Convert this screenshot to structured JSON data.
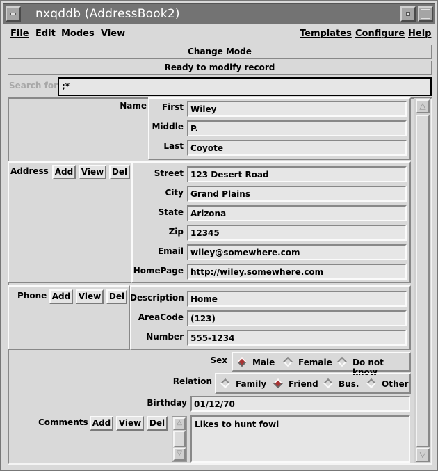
{
  "window": {
    "title": "nxqddb (AddressBook2)"
  },
  "menu": {
    "file": "File",
    "edit": "Edit",
    "modes": "Modes",
    "view": "View",
    "templates": "Templates",
    "configure": "Configure",
    "help": "Help"
  },
  "status": {
    "change_mode": "Change Mode",
    "message": "Ready to modify record"
  },
  "search": {
    "label": "Search for",
    "value": ";*"
  },
  "name": {
    "label": "Name",
    "first_label": "First",
    "first": "Wiley",
    "middle_label": "Middle",
    "middle": "P.",
    "last_label": "Last",
    "last": "Coyote"
  },
  "address": {
    "label": "Address",
    "add": "Add",
    "view": "View",
    "del": "Del",
    "street_label": "Street",
    "street": "123 Desert Road",
    "city_label": "City",
    "city": "Grand Plains",
    "state_label": "State",
    "state": "Arizona",
    "zip_label": "Zip",
    "zip": "12345",
    "email_label": "Email",
    "email": "wiley@somewhere.com",
    "homepage_label": "HomePage",
    "homepage": "http://wiley.somewhere.com"
  },
  "phone": {
    "label": "Phone",
    "add": "Add",
    "view": "View",
    "del": "Del",
    "description_label": "Description",
    "description": "Home",
    "areacode_label": "AreaCode",
    "areacode": "(123)",
    "number_label": "Number",
    "number": "555-1234"
  },
  "sex": {
    "label": "Sex",
    "options": [
      "Male",
      "Female",
      "Do not know"
    ],
    "selected": "Male"
  },
  "relation": {
    "label": "Relation",
    "options": [
      "Family",
      "Friend",
      "Bus.",
      "Other"
    ],
    "selected": "Friend"
  },
  "birthday": {
    "label": "Birthday",
    "value": "01/12/70"
  },
  "comments": {
    "label": "Comments",
    "add": "Add",
    "view": "View",
    "del": "Del",
    "value": "Likes to hunt fowl"
  },
  "colors": {
    "titlebar": "#737373",
    "background": "#d9d9d9",
    "radio_selected": "#aa3333"
  }
}
